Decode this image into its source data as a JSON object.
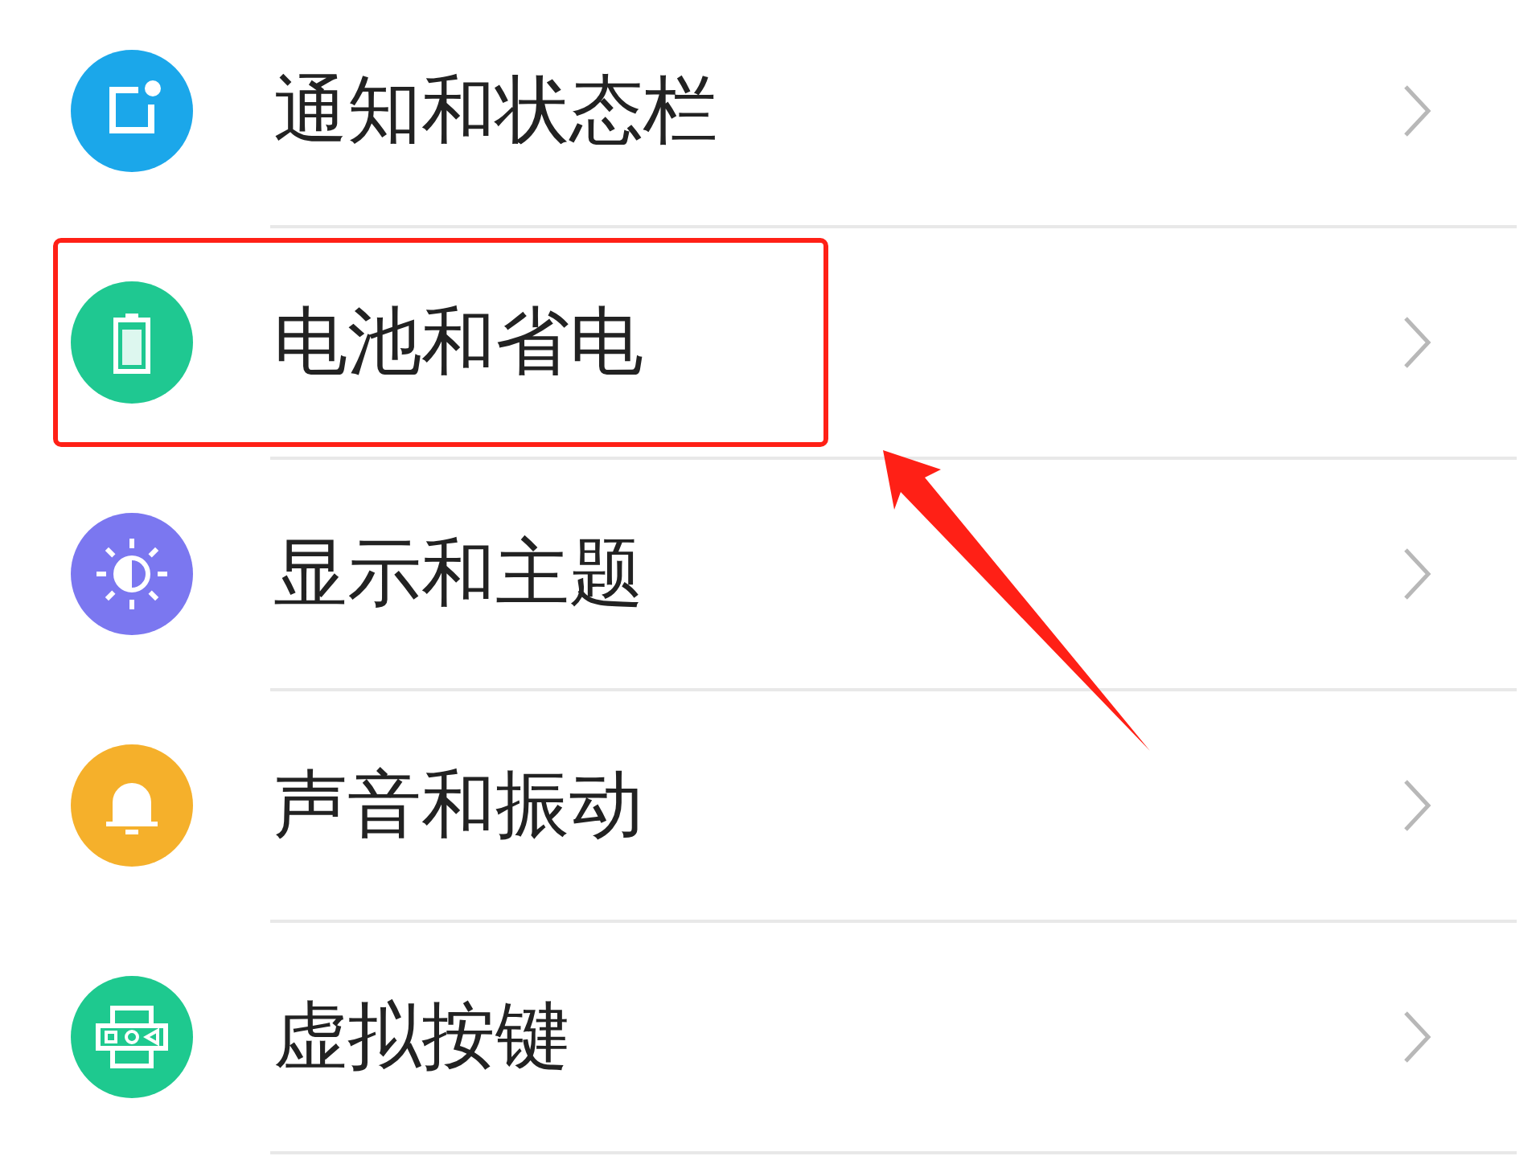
{
  "settings": [
    {
      "label": "通知和状态栏",
      "kind": "notification",
      "color": "#1ba7ea",
      "highlighted": false
    },
    {
      "label": "电池和省电",
      "kind": "battery",
      "color": "#1fc891",
      "highlighted": true
    },
    {
      "label": "显示和主题",
      "kind": "display",
      "color": "#7b77f0",
      "highlighted": false
    },
    {
      "label": "声音和振动",
      "kind": "sound",
      "color": "#f5b02b",
      "highlighted": false
    },
    {
      "label": "虚拟按键",
      "kind": "keys",
      "color": "#1ec98f",
      "highlighted": false
    }
  ]
}
